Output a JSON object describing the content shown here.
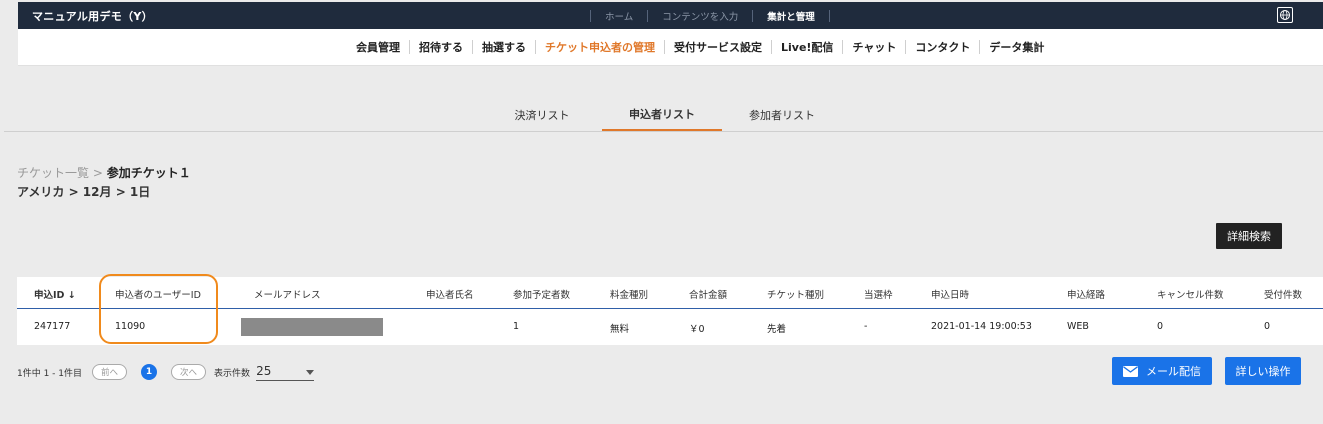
{
  "app": {
    "title": "マニュアル用デモ（Y）"
  },
  "topnav": {
    "items": [
      "ホーム",
      "コンテンツを入力",
      "集計と管理"
    ],
    "active": 2
  },
  "subnav": {
    "items": [
      "会員管理",
      "招待する",
      "抽選する",
      "チケット申込者の管理",
      "受付サービス設定",
      "Live!配信",
      "チャット",
      "コンタクト",
      "データ集計"
    ],
    "active": 3
  },
  "tabs": [
    "決済リスト",
    "申込者リスト",
    "参加者リスト"
  ],
  "breadcrumb": {
    "parent": "チケット一覧",
    "separator": " > ",
    "current": "参加チケット１",
    "path": "アメリカ > 12月 > 1日"
  },
  "buttons": {
    "advanced_search": "詳細検索",
    "mail": "メール配信",
    "detail_ops": "詳しい操作"
  },
  "table": {
    "headers": [
      "申込ID ↓",
      "申込者のユーザーID",
      "メールアドレス",
      "申込者氏名",
      "参加予定者数",
      "料金種別",
      "合計金額",
      "チケット種別",
      "当選枠",
      "申込日時",
      "申込経路",
      "キャンセル件数",
      "受付件数"
    ],
    "rows": [
      [
        "247177",
        "11090",
        "",
        "",
        "1",
        "無料",
        "￥0",
        "先着",
        "-",
        "2021-01-14 19:00:53",
        "WEB",
        "0",
        "0"
      ]
    ]
  },
  "pager": {
    "summary": "1件中 1 - 1件目",
    "prev": "前へ",
    "page": "1",
    "next": "次へ",
    "per_page_label": "表示件数",
    "per_page": "25"
  },
  "colors": {
    "accent": "#e0782a",
    "primary": "#1a73e8",
    "header_bg": "#1f2b3d"
  }
}
